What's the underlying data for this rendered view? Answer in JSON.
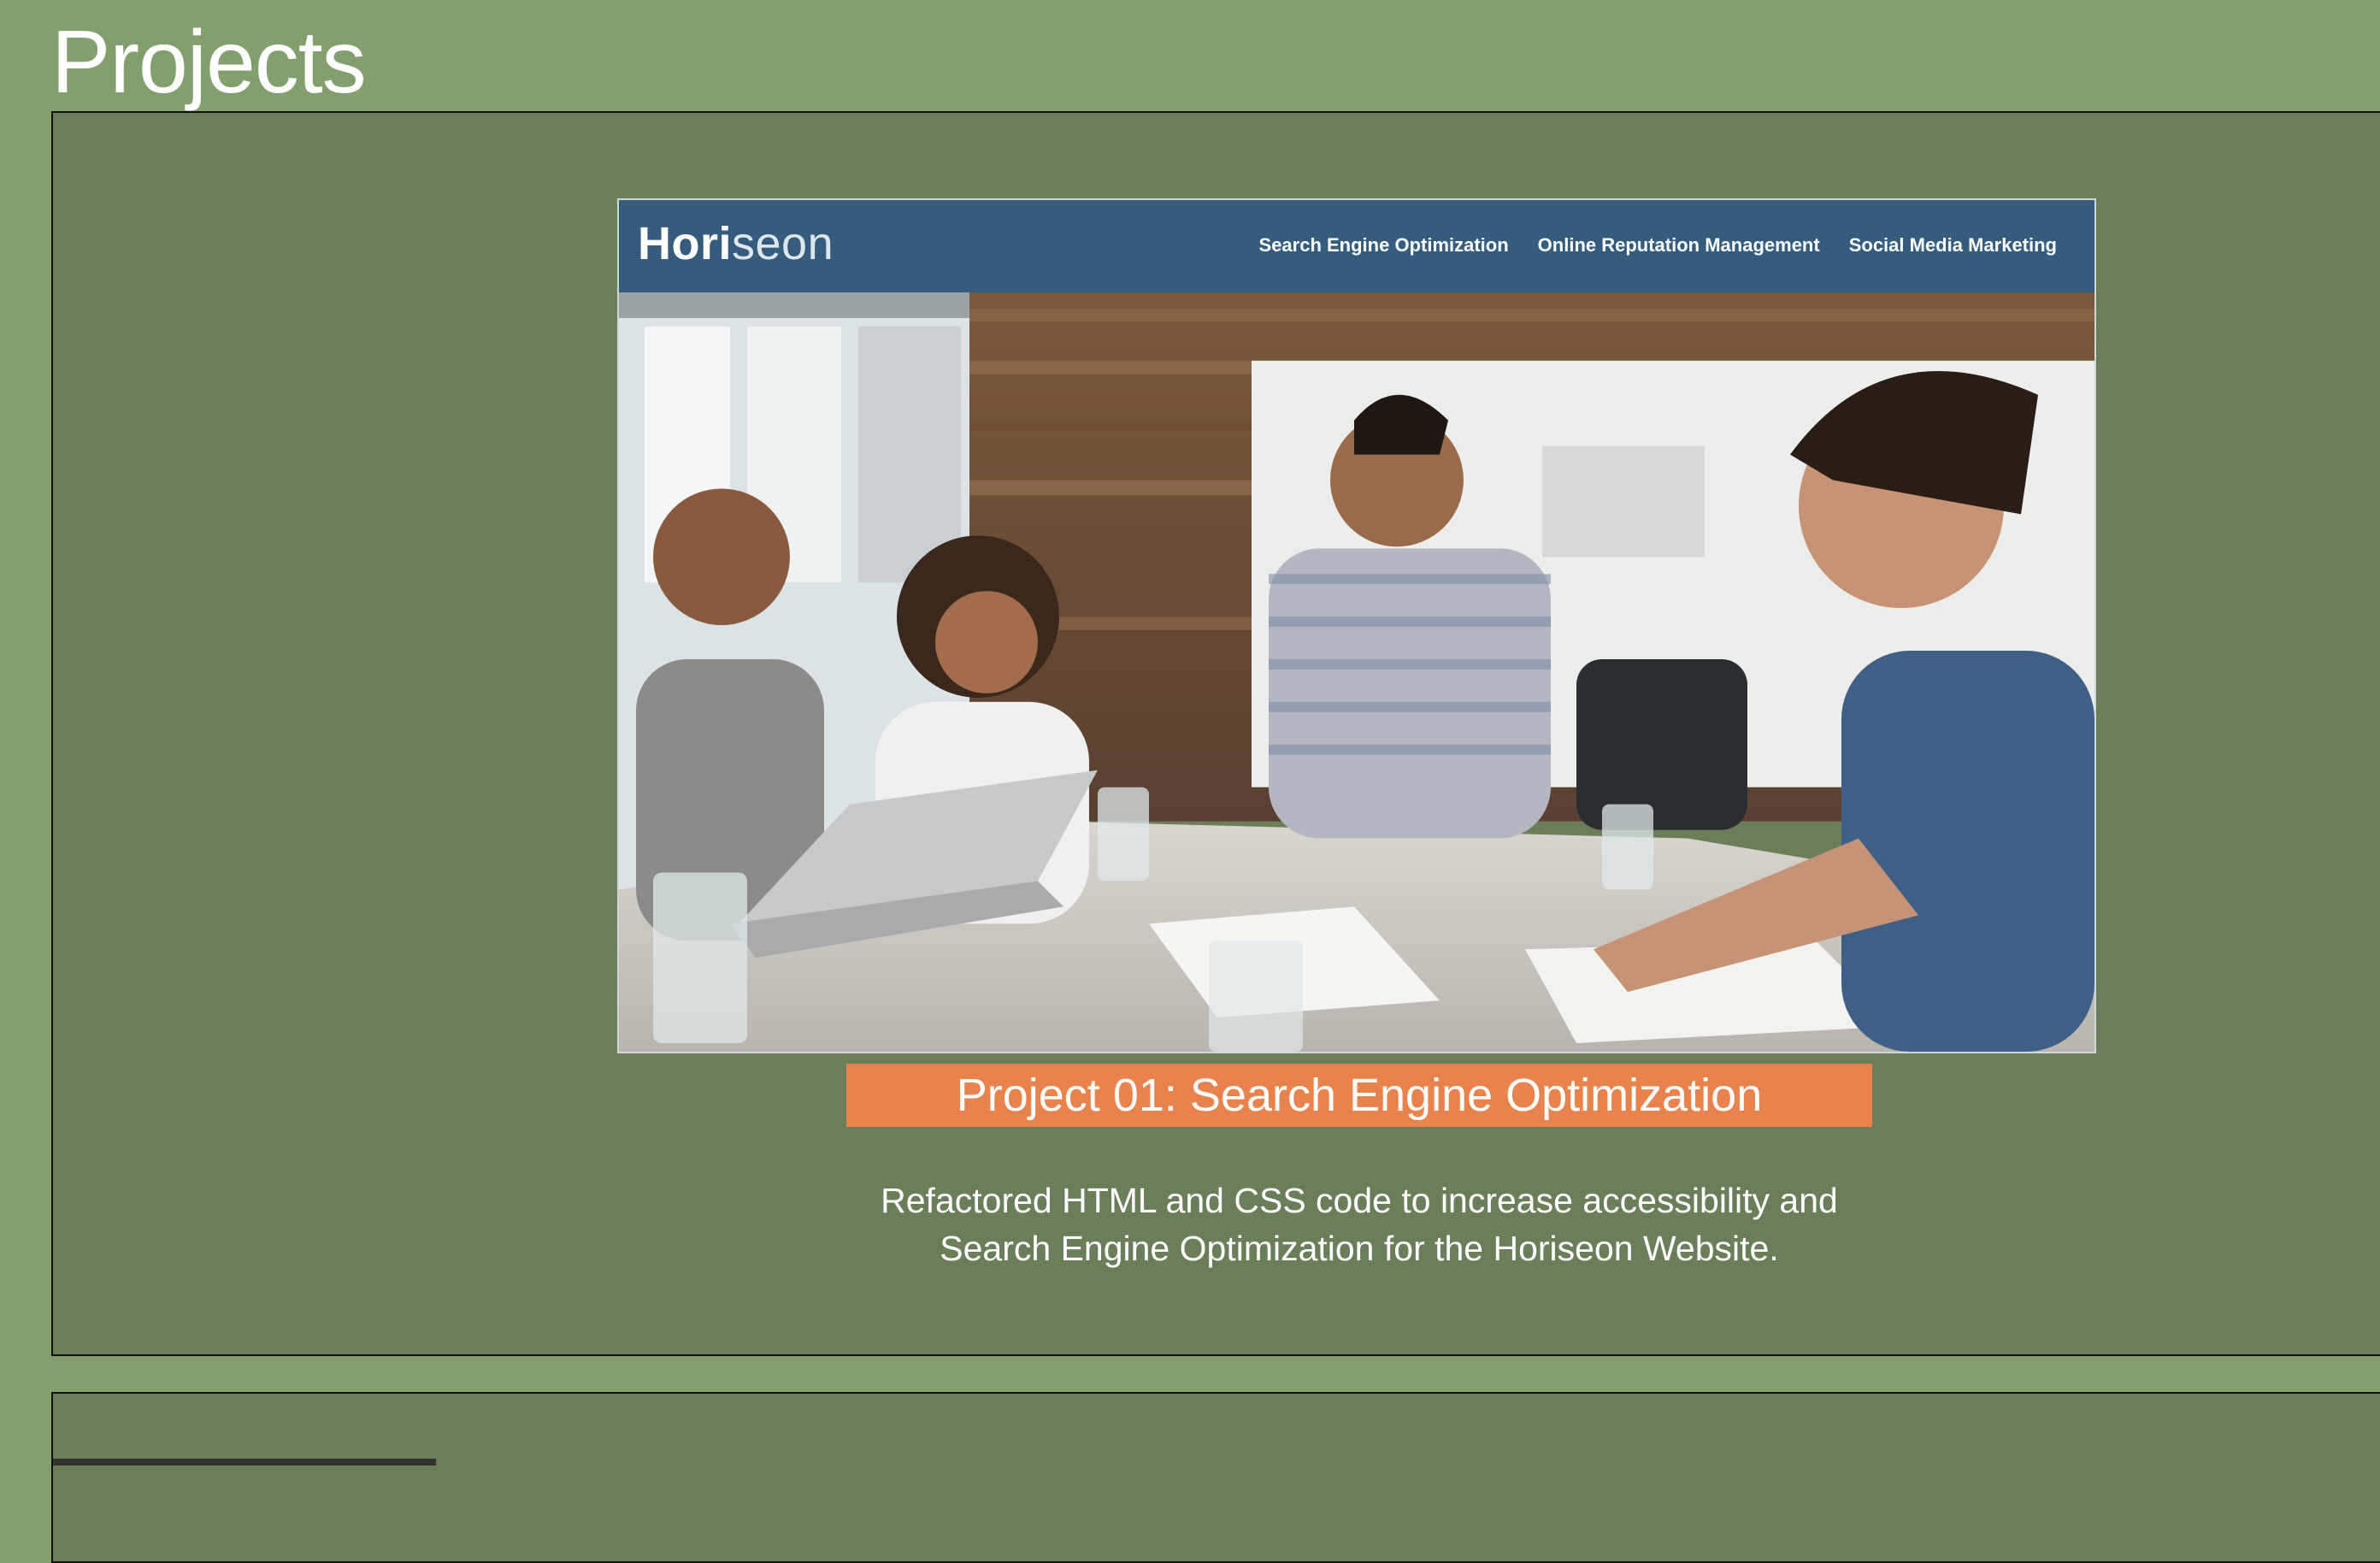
{
  "page": {
    "title": "Projects"
  },
  "projects": [
    {
      "screenshot": {
        "logo_bold": "Hori",
        "logo_light": "seon",
        "nav": [
          "Search Engine Optimization",
          "Online Reputation Management",
          "Social Media Marketing"
        ],
        "photo": "team-meeting-photo"
      },
      "title": "Project 01: Search Engine Optimization",
      "description": "Refactored HTML and CSS code to increase accessibility and Search Engine Optimization for the Horiseon Website."
    }
  ],
  "colors": {
    "page_bg": "#81a06d",
    "card_bg": "#6a7f59",
    "title_bar": "#e8834e",
    "site_header": "#355c7d"
  }
}
